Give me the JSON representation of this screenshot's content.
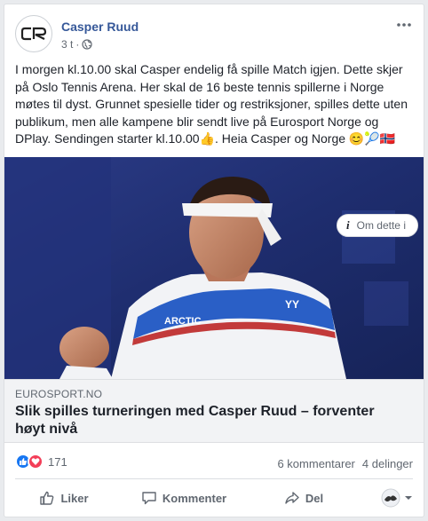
{
  "post": {
    "author": "Casper Ruud",
    "avatar_initials": "CR",
    "time": "3 t",
    "time_separator": "·",
    "audience_icon": "globe-icon",
    "more_icon": "ellipsis-icon",
    "text": "I morgen kl.10.00 skal Casper endelig få spille Match igjen. Dette skjer på Oslo Tennis Arena. Her skal de 16 beste tennis spillerne i Norge møtes til dyst. Grunnet spesielle tider og restriksjoner, spilles dette uten publikum, men alle kampene blir sendt live på Eurosport Norge og DPlay. Sendingen starter kl.10.00👍. Heia Casper og Norge 😊🎾🇳🇴"
  },
  "media": {
    "shirt_text": "ARCTIC",
    "about_label": "Om dette i",
    "about_icon": "info-icon"
  },
  "link": {
    "domain": "EUROSPORT.NO",
    "title": "Slik spilles turneringen med Casper Ruud – forventer høyt nivå"
  },
  "stats": {
    "reaction_icons": [
      "like-icon",
      "love-icon"
    ],
    "reaction_count": "171",
    "comments": "6 kommentarer",
    "shares": "4 delinger"
  },
  "actions": {
    "like": "Liker",
    "comment": "Kommenter",
    "share": "Del"
  },
  "colors": {
    "link_blue": "#365899",
    "like_blue": "#1877f2",
    "love_red": "#f33e58",
    "court_blue": "#24357a"
  }
}
